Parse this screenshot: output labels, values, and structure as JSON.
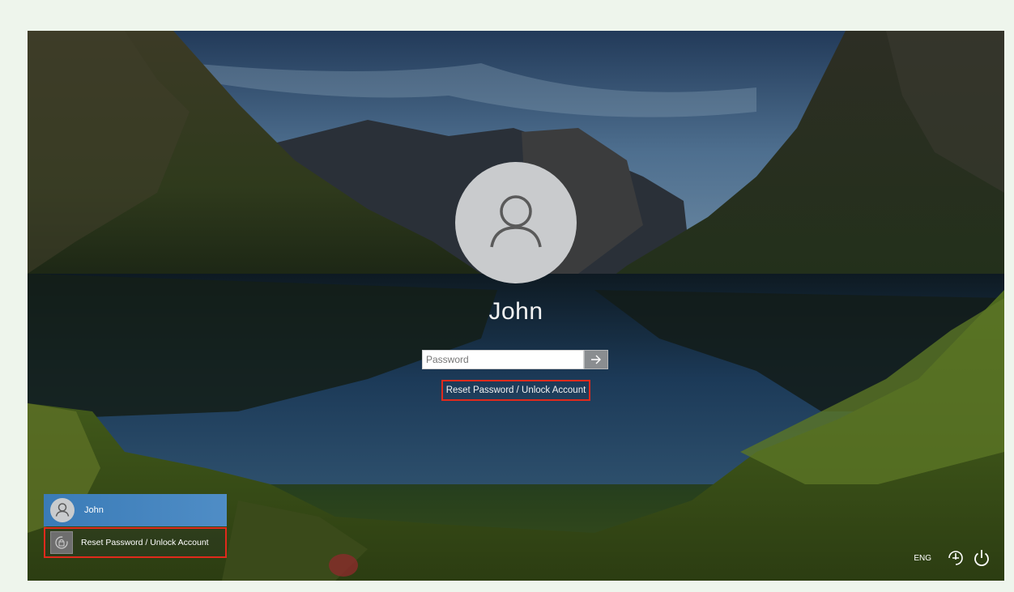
{
  "login": {
    "username": "John",
    "password_placeholder": "Password",
    "reset_link": "Reset Password / Unlock Account"
  },
  "user_list": {
    "items": [
      {
        "label": "John",
        "icon": "user-icon"
      },
      {
        "label": "Reset Password / Unlock Account",
        "icon": "reset-password-icon"
      }
    ]
  },
  "tray": {
    "language": "ENG",
    "ease_of_access_icon": "ease-of-access-icon",
    "power_icon": "power-icon"
  },
  "colors": {
    "highlight": "#e02a1c",
    "user_tile": "#3a7bb7"
  }
}
